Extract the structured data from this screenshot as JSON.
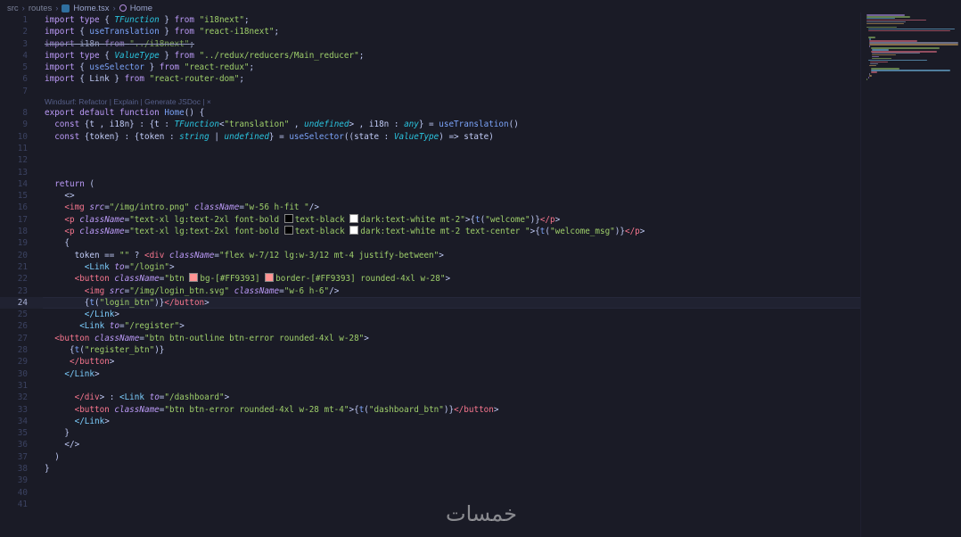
{
  "breadcrumb": {
    "items": [
      "src",
      "routes",
      "Home.tsx",
      "Home"
    ]
  },
  "codelens": "Windsurf: Refactor | Explain | Generate JSDoc | ×",
  "current_line": 24,
  "line_numbers": [
    "1",
    "2",
    "3",
    "4",
    "5",
    "6",
    "7",
    "8",
    "9",
    "10",
    "11",
    "12",
    "13",
    "14",
    "15",
    "16",
    "17",
    "18",
    "19",
    "20",
    "21",
    "22",
    "23",
    "24",
    "25",
    "26",
    "27",
    "28",
    "29",
    "30",
    "31",
    "32",
    "33",
    "34",
    "35",
    "36",
    "37",
    "38",
    "39",
    "40",
    "41"
  ],
  "code_lines": [
    "import type { TFunction } from \"i18next\";",
    "import { useTranslation } from \"react-i18next\";",
    "import i18n from \"../i18next\";",
    "import type { ValueType } from \"../redux/reducers/Main_reducer\";",
    "import { useSelector } from \"react-redux\";",
    "import { Link } from \"react-router-dom\";",
    "",
    "export default function Home() {",
    "  const {t , i18n} : {t : TFunction<\"translation\" , undefined> , i18n : any} = useTranslation()",
    "  const {token} : {token : string | undefined} = useSelector((state : ValueType) => state)",
    "",
    "",
    "",
    "  return (",
    "    <>",
    "    <img src=\"/img/intro.png\" className=\"w-56 h-fit \"/>",
    "    <p className=\"text-xl lg:text-2xl font-bold text-black dark:text-white mt-2\">{t(\"welcome\")}</p>",
    "    <p className=\"text-xl lg:text-2xl font-bold text-black dark:text-white mt-2 text-center \">{t(\"welcome_msg\")}</p>",
    "    {",
    "      token == \"\" ? <div className=\"flex w-7/12 lg:w-3/12 mt-4 justify-between\">",
    "        <Link to=\"/login\">",
    "      <button className=\"btn bg-[#FF9393] border-[#FF9393] rounded-4xl w-28\">",
    "        <img src=\"/img/login_btn.svg\" className=\"w-6 h-6\"/>",
    "        {t(\"login_btn\")}</button>",
    "        </Link>",
    "       <Link to=\"/register\">",
    "  <button className=\"btn btn-outline btn-error rounded-4xl w-28\">",
    "     {t(\"register_btn\")}",
    "     </button>",
    "    </Link>",
    "",
    "      </div> : <Link to=\"/dashboard\">",
    "      <button className=\"btn btn-error rounded-4xl w-28 mt-4\">{t(\"dashboard_btn\")}</button>",
    "      </Link>",
    "    }",
    "    </>",
    "  )",
    "}",
    "",
    "",
    ""
  ],
  "colors": {
    "background": "#1a1b26",
    "keyword": "#bb9af7",
    "string": "#9ece6a",
    "type": "#2ac3de",
    "tag": "#f7768e",
    "component": "#7dcfff",
    "function": "#7aa2f7",
    "swatch_black": "#000000",
    "swatch_white": "#ffffff",
    "swatch_pink": "#FF9393"
  },
  "icons": [
    "tsx-file-icon",
    "symbol-function-icon"
  ],
  "watermark": "خمسات"
}
